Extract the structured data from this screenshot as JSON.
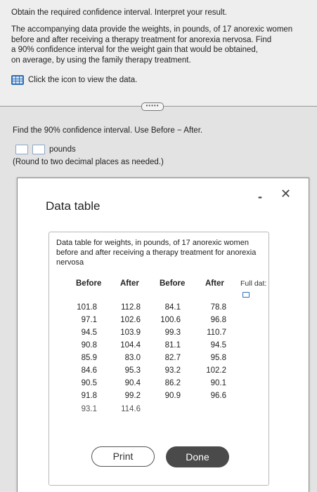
{
  "question": {
    "title": "Obtain the required confidence interval. Interpret your result.",
    "text_lines": [
      "The accompanying data provide the weights, in pounds, of 17 anorexic women",
      "before and after receiving a therapy treatment for anorexia nervosa. Find",
      "a 90% confidence interval for the weight gain that would be obtained,",
      "on average, by using the family therapy treatment."
    ],
    "data_link": "Click the icon to view the data.",
    "more": "•••••"
  },
  "part": {
    "prompt": "Find the 90% confidence interval. Use Before − After.",
    "unit": "pounds",
    "note": "(Round to two decimal places as needed.)"
  },
  "modal": {
    "title": "Data table",
    "minimize": "-",
    "close": "✕",
    "caption": "Data table for weights, in pounds, of 17 anorexic women before and after receiving a therapy treatment for anorexia nervosa",
    "headers": [
      "Before",
      "After",
      "Before",
      "After"
    ],
    "full_data": "Full dat:",
    "rows": [
      [
        "101.8",
        "112.8",
        "84.1",
        "78.8"
      ],
      [
        "97.1",
        "102.6",
        "100.6",
        "96.8"
      ],
      [
        "94.5",
        "103.9",
        "99.3",
        "110.7"
      ],
      [
        "90.8",
        "104.4",
        "81.1",
        "94.5"
      ],
      [
        "85.9",
        "83.0",
        "82.7",
        "95.8"
      ],
      [
        "84.6",
        "95.3",
        "93.2",
        "102.2"
      ],
      [
        "90.5",
        "90.4",
        "86.2",
        "90.1"
      ],
      [
        "91.8",
        "99.2",
        "90.9",
        "96.6"
      ],
      [
        "93.1",
        "114.6",
        "",
        ""
      ]
    ],
    "print_label": "Print",
    "done_label": "Done"
  }
}
